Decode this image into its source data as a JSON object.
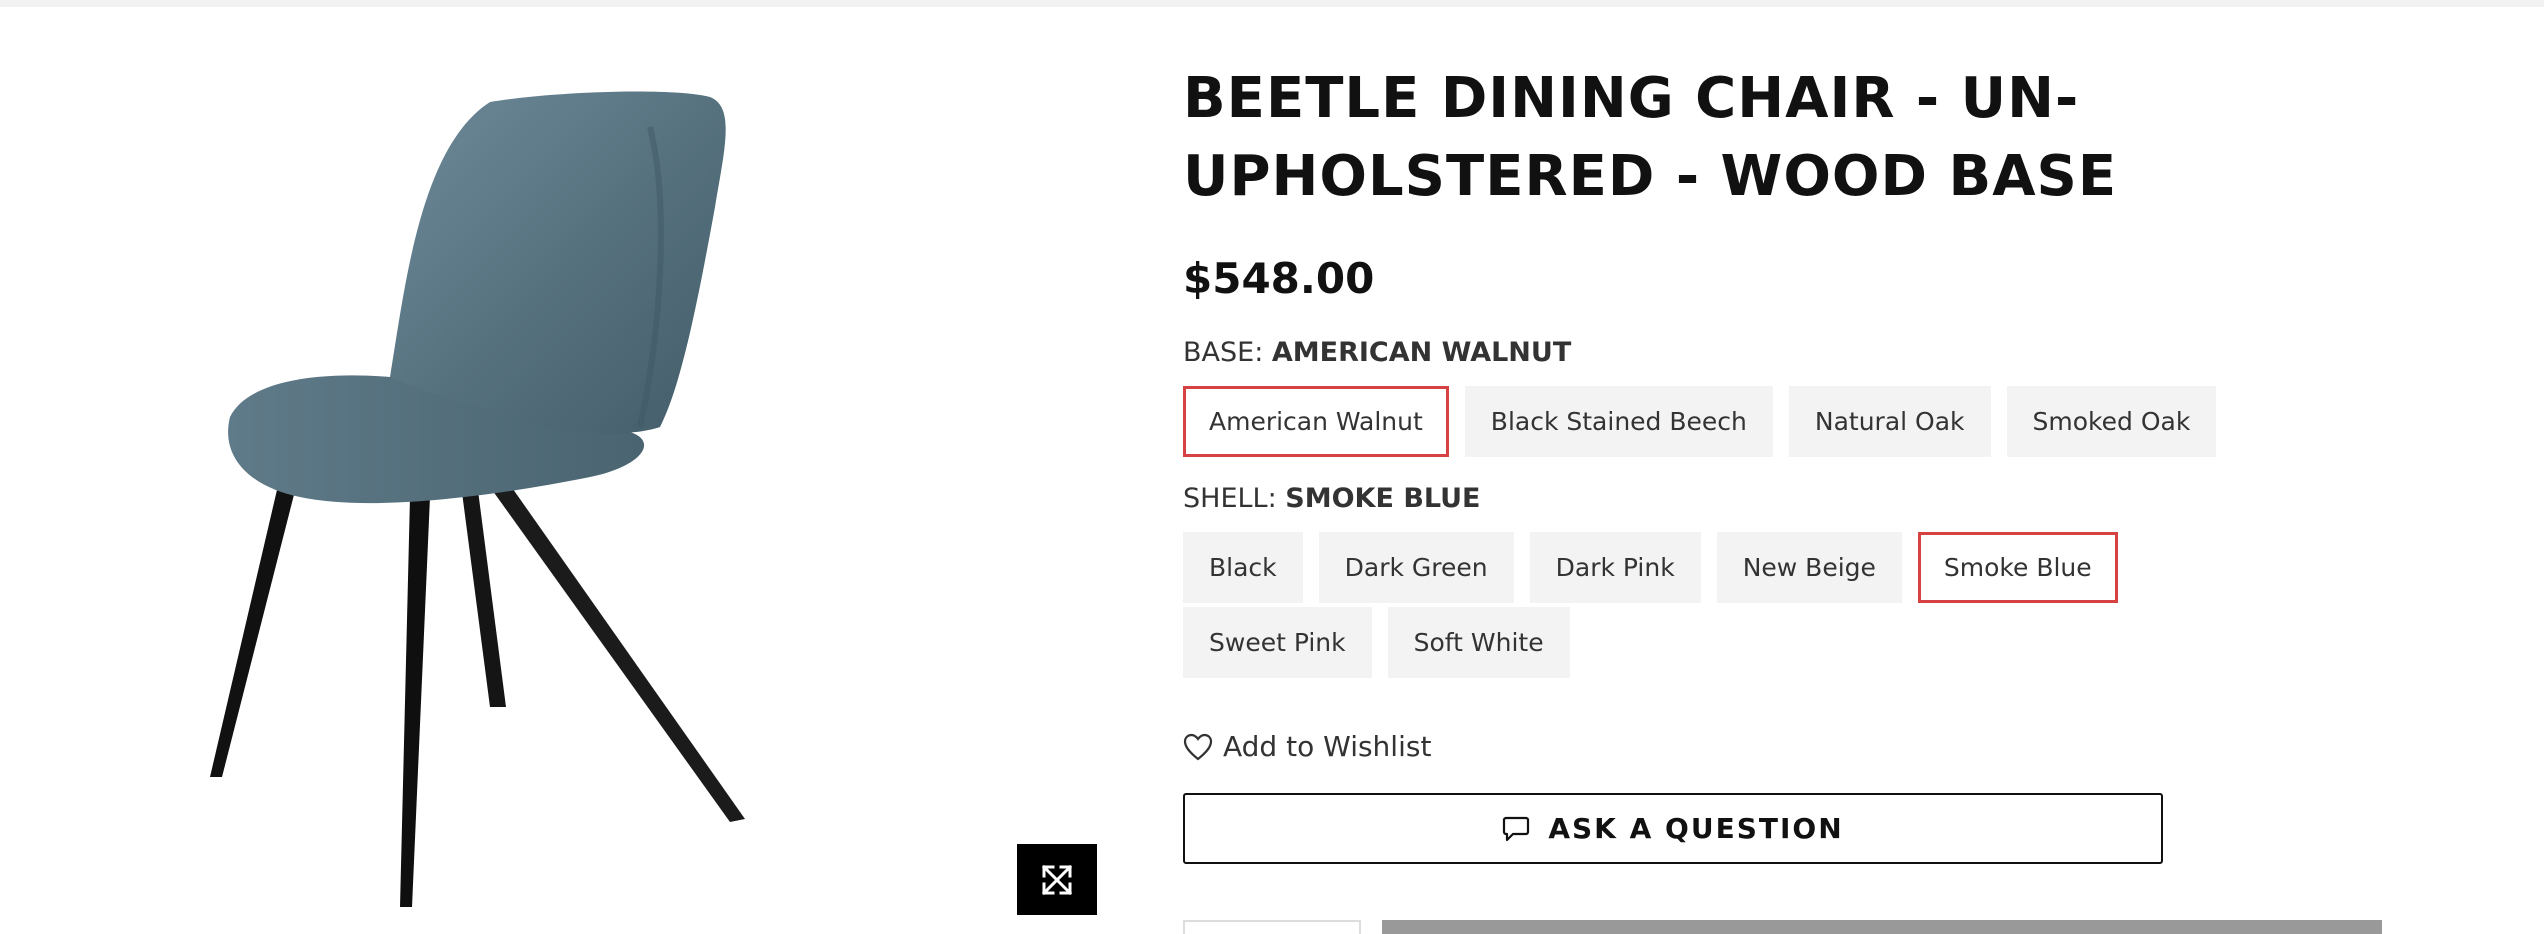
{
  "product": {
    "title": "BEETLE DINING CHAIR - UN- UPHOLSTERED - WOOD BASE",
    "price": "$548.00"
  },
  "base": {
    "label": "BASE:",
    "selected": "AMERICAN WALNUT",
    "options": [
      "American Walnut",
      "Black Stained Beech",
      "Natural Oak",
      "Smoked Oak"
    ]
  },
  "shell": {
    "label": "SHELL:",
    "selected": "SMOKE BLUE",
    "options": [
      "Black",
      "Dark Green",
      "Dark Pink",
      "New Beige",
      "Smoke Blue",
      "Sweet Pink",
      "Soft White"
    ]
  },
  "actions": {
    "wishlist_label": "Add to Wishlist",
    "ask_label": "ASK A QUESTION"
  },
  "icons": {
    "zoom": "expand-icon",
    "wishlist": "heart-icon",
    "ask": "speech-bubble-icon"
  },
  "colors": {
    "selected_border": "#d64242",
    "swatch_bg": "#f3f3f3",
    "chair_shell": "#5a7585",
    "chair_legs": "#1a1a1a"
  }
}
